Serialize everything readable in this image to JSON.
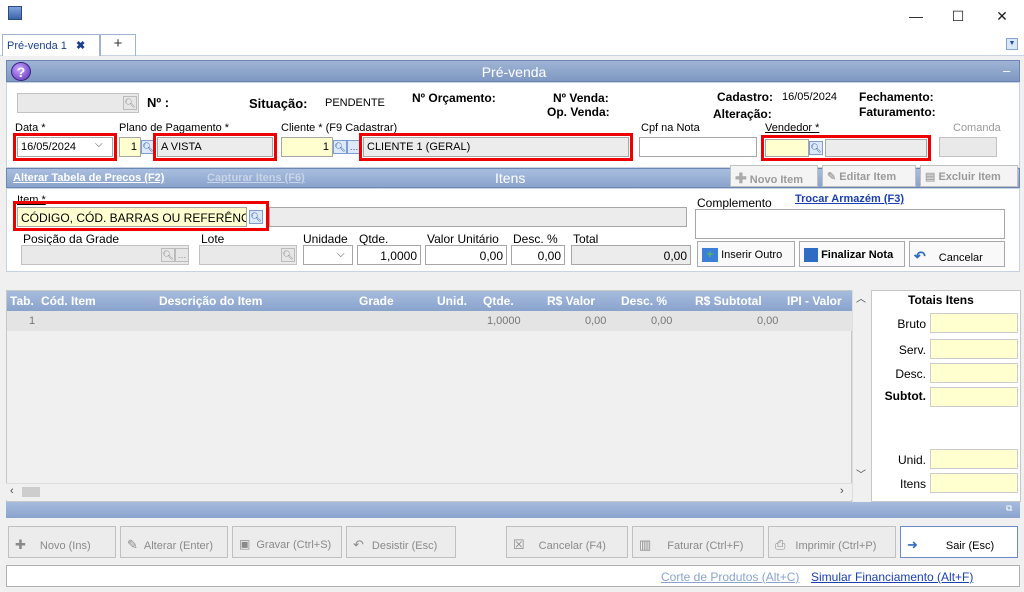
{
  "window": {
    "minimize": "—",
    "maximize": "☐",
    "close": "✕"
  },
  "tabs": {
    "active": "Pré-venda 1",
    "close": "✖",
    "add": "+"
  },
  "header": {
    "title": "Pré-venda",
    "help": "?",
    "collapse": "–"
  },
  "top": {
    "numero_label": "Nº :",
    "situacao_label": "Situação:",
    "situacao_value": "PENDENTE",
    "orcamento_label": "Nº Orçamento:",
    "venda_label": "Nº Venda:",
    "opvenda_label": "Op. Venda:",
    "cadastro_label": "Cadastro:",
    "cadastro_value": "16/05/2024",
    "alteracao_label": "Alteração:",
    "fechamento_label": "Fechamento:",
    "faturamento_label": "Faturamento:",
    "data_label": "Data *",
    "data_value": "16/05/2024",
    "plano_label": "Plano de Pagamento *",
    "plano_code": "1",
    "plano_name": "A VISTA",
    "cliente_label": "Cliente * (F9 Cadastrar)",
    "cliente_code": "1",
    "cliente_name": "CLIENTE 1 (GERAL)",
    "cpf_label": "Cpf na Nota",
    "vendedor_label": "Vendedor *",
    "comanda_label": "Comanda"
  },
  "itens_bar": {
    "alterar": "Alterar Tabela de Precos (F2)",
    "capturar": "Capturar Itens (F6)",
    "title": "Itens",
    "novo": "Novo Item",
    "editar": "Editar Item",
    "excluir": "Excluir Item"
  },
  "item_panel": {
    "item_label": "Item *",
    "item_placeholder": "CÓDIGO, CÓD. BARRAS OU REFERÊNCIA",
    "complemento_label": "Complemento",
    "trocar": "Trocar Armazém (F3)",
    "posicao_label": "Posição da Grade",
    "lote_label": "Lote",
    "unidade_label": "Unidade",
    "qtde_label": "Qtde.",
    "qtde_value": "1,0000",
    "valor_label": "Valor Unitário",
    "valor_value": "0,00",
    "desc_label": "Desc. %",
    "desc_value": "0,00",
    "total_label": "Total",
    "total_value": "0,00",
    "inserir": "Inserir Outro",
    "finalizar": "Finalizar Nota",
    "cancelar": "Cancelar"
  },
  "grid": {
    "columns": [
      "Tab.",
      "Cód. Item",
      "Descrição do Item",
      "Grade",
      "Unid.",
      "Qtde.",
      "R$ Valor",
      "Desc. %",
      "R$ Subtotal",
      "IPI - Valor"
    ],
    "rows": [
      {
        "tab": "1",
        "qtde": "1,0000",
        "valor": "0,00",
        "desc": "0,00",
        "subtotal": "0,00"
      }
    ]
  },
  "totais": {
    "title": "Totais Itens",
    "bruto": "Bruto",
    "serv": "Serv.",
    "desc": "Desc.",
    "subtot": "Subtot.",
    "unid": "Unid.",
    "itens": "Itens"
  },
  "bottom": {
    "novo": "Novo (Ins)",
    "alterar": "Alterar (Enter)",
    "gravar": "Gravar (Ctrl+S)",
    "desistir": "Desistir (Esc)",
    "cancelar": "Cancelar (F4)",
    "faturar": "Faturar (Ctrl+F)",
    "imprimir": "Imprimir (Ctrl+P)",
    "sair": "Sair (Esc)"
  },
  "status": {
    "corte": "Corte de Produtos (Alt+C)",
    "simular": "Simular Financiamento (Alt+F)"
  }
}
